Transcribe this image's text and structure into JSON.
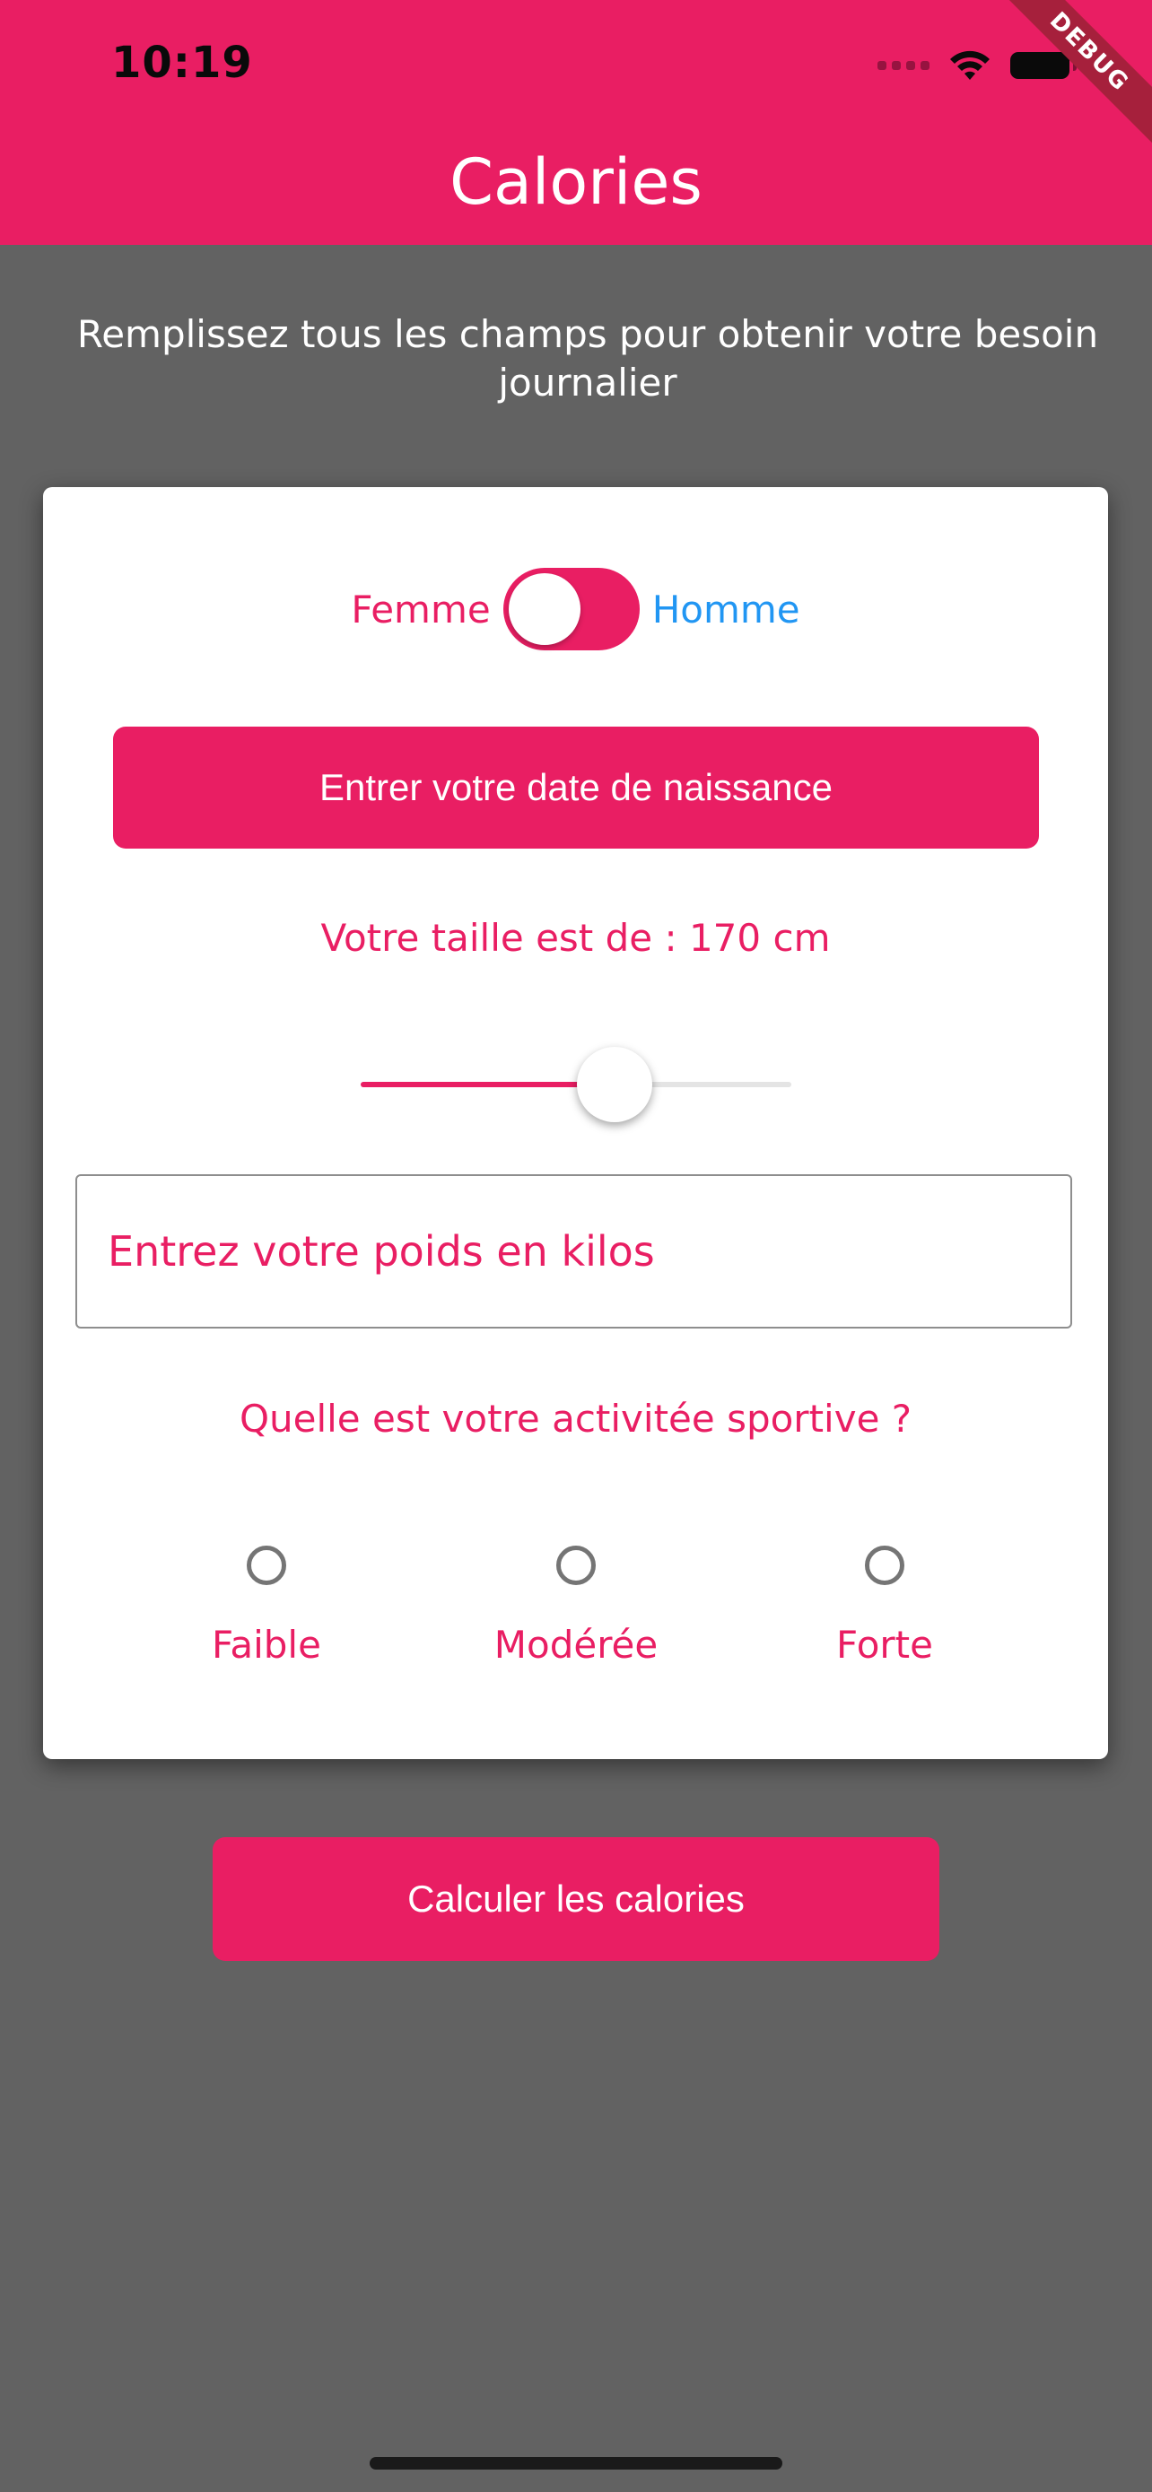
{
  "status_bar": {
    "time": "10:19",
    "icons": [
      "signal-dots-icon",
      "wifi-icon",
      "battery-icon"
    ]
  },
  "debug_banner": "DEBUG",
  "app_bar": {
    "title": "Calories"
  },
  "instructions": "Remplissez tous les champs pour obtenir votre besoin journalier",
  "form": {
    "gender": {
      "left_label": "Femme",
      "right_label": "Homme",
      "switch_on": false
    },
    "birthdate_button": "Entrer votre date de naissance",
    "height": {
      "label": "Votre taille est de : 170 cm",
      "slider_fraction": 0.59
    },
    "weight": {
      "placeholder": "Entrez votre poids en kilos",
      "value": ""
    },
    "activity": {
      "question": "Quelle est votre activitée sportive ?",
      "options": [
        {
          "label": "Faible",
          "selected": false
        },
        {
          "label": "Modérée",
          "selected": false
        },
        {
          "label": "Forte",
          "selected": false
        }
      ]
    }
  },
  "calculate_button": "Calculer les calories",
  "colors": {
    "primary": "#E91E63",
    "secondary_blue": "#2196F3",
    "background": "#626262",
    "card": "#FFFFFF"
  }
}
